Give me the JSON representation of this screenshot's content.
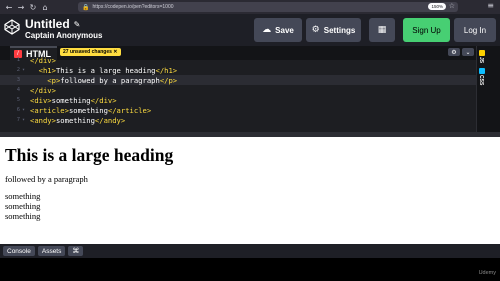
{
  "browser": {
    "back": "←",
    "forward": "→",
    "reload": "↻",
    "home": "⌂",
    "lock": "🔒",
    "url": "https://codepen.io/pen?editors=1000",
    "zoom": "150%",
    "star": "☆",
    "menu": "≡"
  },
  "header": {
    "title": "Untitled",
    "pencil": "✎",
    "author": "Captain Anonymous",
    "save_label": "Save",
    "save_icon": "☁",
    "settings_label": "Settings",
    "settings_icon": "⚙",
    "layout_icon": "▦",
    "signup_label": "Sign Up",
    "login_label": "Log In"
  },
  "editor": {
    "tab_label": "HTML",
    "tab_badge": "/",
    "unsaved": "27 unsaved changes ✕",
    "gear": "⚙",
    "chevron": "⌄",
    "lines": [
      {
        "num": "1",
        "fold": "",
        "text": "</div>"
      },
      {
        "num": "2",
        "fold": "▾",
        "pre": "  <h1>",
        "mid": "This is a large heading",
        "post": "</h1>"
      },
      {
        "num": "3",
        "fold": "",
        "pre": "    <p>",
        "mid": "followed by a paragraph",
        "post": "</p>"
      },
      {
        "num": "4",
        "fold": "",
        "pre": "</div>",
        "mid": "",
        "post": ""
      },
      {
        "num": "5",
        "fold": "",
        "pre": "<div>",
        "mid": "something",
        "post": "</div>"
      },
      {
        "num": "6",
        "fold": "▾",
        "pre": "<article>",
        "mid": "something",
        "post": "</article>"
      },
      {
        "num": "7",
        "fold": "▾",
        "pre": "<andy>",
        "mid": "something",
        "post": "</andy>"
      }
    ],
    "side_css": "CSS",
    "side_js": "JS"
  },
  "preview": {
    "heading": "This is a large heading",
    "paragraph": "followed by a paragraph",
    "items": [
      "something",
      "something",
      "something"
    ]
  },
  "bottom": {
    "console": "Console",
    "assets": "Assets",
    "shortcuts_icon": "⌘"
  },
  "watermark": "Udemy",
  "colors": {
    "accent_signup": "#47cf73",
    "html_badge": "#ff3c41",
    "unsaved_badge": "#ffdd40",
    "tag": "#ffdd40"
  }
}
